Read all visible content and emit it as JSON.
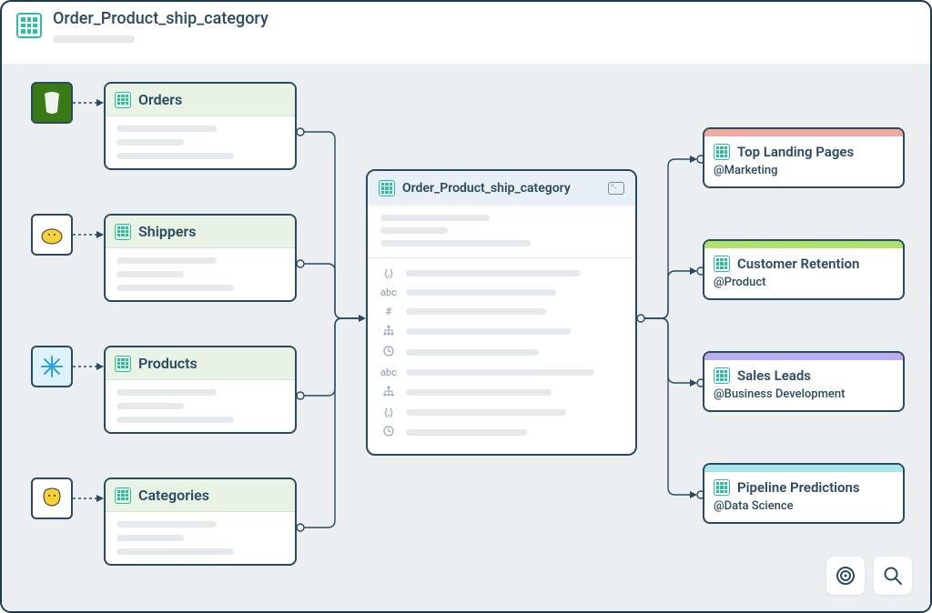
{
  "header": {
    "title": "Order_Product_ship_category"
  },
  "sources": [
    {
      "name": "Orders"
    },
    {
      "name": "Shippers"
    },
    {
      "name": "Products"
    },
    {
      "name": "Categories"
    }
  ],
  "center": {
    "title": "Order_Product_ship_category",
    "fields": [
      {
        "glyph": "{,}"
      },
      {
        "glyph": "abc"
      },
      {
        "glyph": "#"
      },
      {
        "glyph": "tree"
      },
      {
        "glyph": "clock"
      },
      {
        "glyph": "abc"
      },
      {
        "glyph": "tree"
      },
      {
        "glyph": "{,}"
      },
      {
        "glyph": "clock"
      }
    ]
  },
  "outputs": [
    {
      "title": "Top Landing Pages",
      "owner": "@Marketing",
      "color": "#f1a8a0"
    },
    {
      "title": "Customer Retention",
      "owner": "@Product",
      "color": "#aee26b"
    },
    {
      "title": "Sales Leads",
      "owner": "@Business Development",
      "color": "#b9aef0"
    },
    {
      "title": "Pipeline Predictions",
      "owner": "@Data Science",
      "color": "#a9e6e9"
    }
  ]
}
